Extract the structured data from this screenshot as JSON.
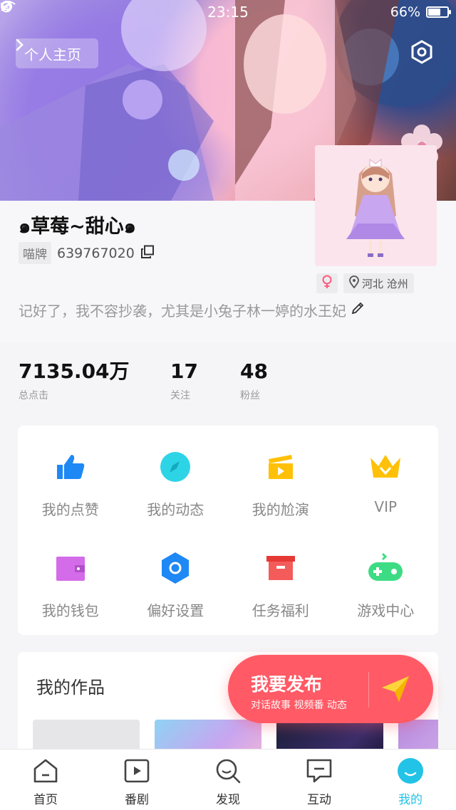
{
  "status_bar": {
    "time": "23:15",
    "battery": "66%",
    "battery_level": 0.66
  },
  "header": {
    "profile_home_label": "个人主页",
    "settings_icon": "hexagon-gear-icon"
  },
  "profile": {
    "username": "๑草莓~甜心๑",
    "id_tag": "喵牌",
    "id_number": "639767020",
    "gender": "female",
    "location": "河北 沧州",
    "bio": "记好了，我不容抄袭，尤其是小兔子林一婷的水王妃"
  },
  "stats": [
    {
      "value": "7135.04万",
      "label": "总点击"
    },
    {
      "value": "17",
      "label": "关注"
    },
    {
      "value": "48",
      "label": "粉丝"
    }
  ],
  "menu": [
    {
      "label": "我的点赞",
      "icon": "thumbs-up-icon",
      "color": "#1e88f5"
    },
    {
      "label": "我的动态",
      "icon": "compass-icon",
      "color": "#2dd4e6"
    },
    {
      "label": "我的尬演",
      "icon": "clapperboard-icon",
      "color": "#ffc107"
    },
    {
      "label": "VIP",
      "icon": "crown-icon",
      "color": "#ffc107"
    },
    {
      "label": "我的钱包",
      "icon": "wallet-icon",
      "color": "#d46be8"
    },
    {
      "label": "偏好设置",
      "icon": "hexagon-settings-icon",
      "color": "#1e88f5"
    },
    {
      "label": "任务福利",
      "icon": "gift-box-icon",
      "color": "#f45b5b"
    },
    {
      "label": "游戏中心",
      "icon": "gamepad-icon",
      "color": "#3ddc84"
    }
  ],
  "works": {
    "title": "我的作品"
  },
  "publish": {
    "title": "我要发布",
    "subtitle": "对话故事 视频番 动态",
    "color": "#ff5a65"
  },
  "nav": [
    {
      "label": "首页",
      "icon": "home-icon",
      "active": false
    },
    {
      "label": "番剧",
      "icon": "play-icon",
      "active": false
    },
    {
      "label": "发现",
      "icon": "search-icon",
      "active": false
    },
    {
      "label": "互动",
      "icon": "chat-icon",
      "active": false
    },
    {
      "label": "我的",
      "icon": "profile-icon",
      "active": true
    }
  ],
  "colors": {
    "accent": "#22c3e6",
    "publish": "#ff5a65"
  }
}
